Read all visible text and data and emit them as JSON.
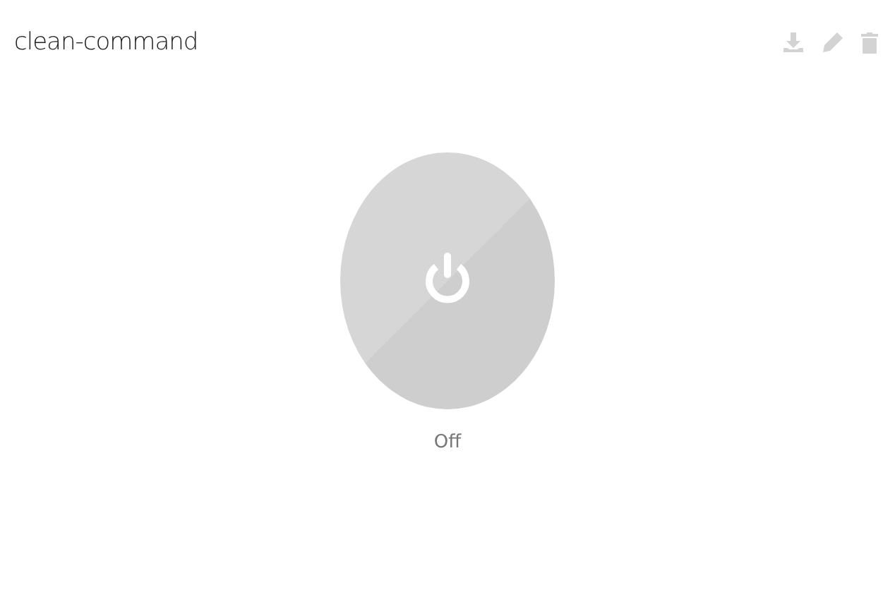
{
  "card": {
    "title": "clean-command"
  },
  "switch": {
    "on": false,
    "label": "Off"
  }
}
